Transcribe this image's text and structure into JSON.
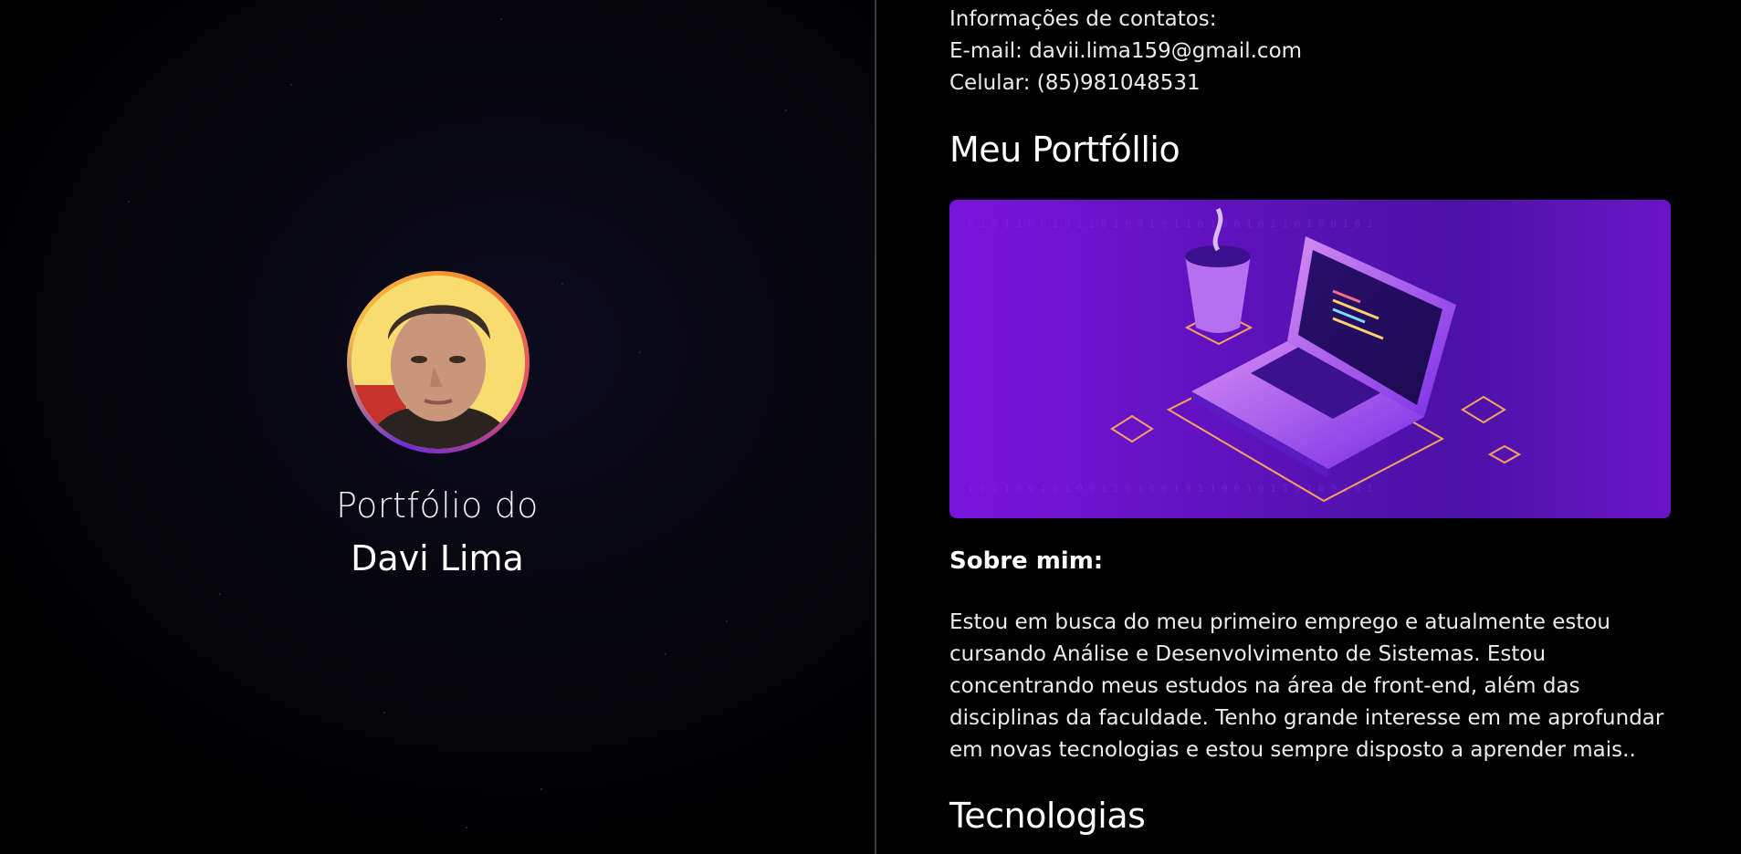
{
  "hero": {
    "subtitle": "Portfólio do",
    "name": "Davi Lima"
  },
  "contact": {
    "heading": "Informações de contatos:",
    "email": "E-mail: davii.lima159@gmail.com",
    "phone": "Celular: (85)981048531"
  },
  "portfolio": {
    "heading": "Meu Portfóllio"
  },
  "about": {
    "heading": "Sobre mim:",
    "text": "Estou em busca do meu primeiro emprego e atualmente estou cursando Análise e Desenvolvimento de Sistemas. Estou concentrando meus estudos na área de front-end, além das disciplinas da faculdade. Tenho grande interesse em me aprofundar em novas tecnologias e estou sempre disposto a aprender mais.."
  },
  "tech": {
    "heading": "Tecnologias"
  },
  "colors": {
    "background": "#000000",
    "banner_purple": "#6a14c8",
    "ring_orange": "#f58a2b",
    "text": "#ffffff"
  }
}
